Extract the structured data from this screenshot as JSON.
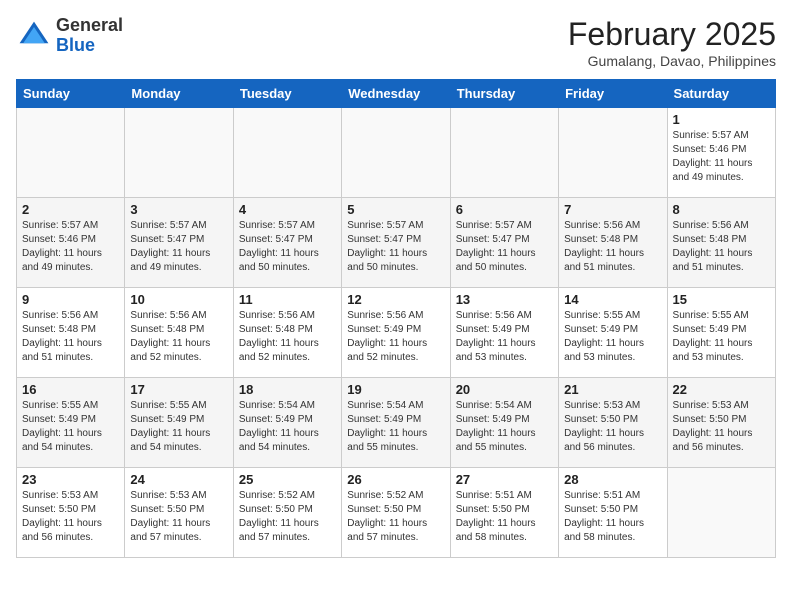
{
  "header": {
    "logo_line1": "General",
    "logo_line2": "Blue",
    "month_year": "February 2025",
    "location": "Gumalang, Davao, Philippines"
  },
  "weekdays": [
    "Sunday",
    "Monday",
    "Tuesday",
    "Wednesday",
    "Thursday",
    "Friday",
    "Saturday"
  ],
  "weeks": [
    [
      {
        "day": "",
        "sunrise": "",
        "sunset": "",
        "daylight": ""
      },
      {
        "day": "",
        "sunrise": "",
        "sunset": "",
        "daylight": ""
      },
      {
        "day": "",
        "sunrise": "",
        "sunset": "",
        "daylight": ""
      },
      {
        "day": "",
        "sunrise": "",
        "sunset": "",
        "daylight": ""
      },
      {
        "day": "",
        "sunrise": "",
        "sunset": "",
        "daylight": ""
      },
      {
        "day": "",
        "sunrise": "",
        "sunset": "",
        "daylight": ""
      },
      {
        "day": "1",
        "sunrise": "Sunrise: 5:57 AM",
        "sunset": "Sunset: 5:46 PM",
        "daylight": "Daylight: 11 hours and 49 minutes."
      }
    ],
    [
      {
        "day": "2",
        "sunrise": "Sunrise: 5:57 AM",
        "sunset": "Sunset: 5:46 PM",
        "daylight": "Daylight: 11 hours and 49 minutes."
      },
      {
        "day": "3",
        "sunrise": "Sunrise: 5:57 AM",
        "sunset": "Sunset: 5:47 PM",
        "daylight": "Daylight: 11 hours and 49 minutes."
      },
      {
        "day": "4",
        "sunrise": "Sunrise: 5:57 AM",
        "sunset": "Sunset: 5:47 PM",
        "daylight": "Daylight: 11 hours and 50 minutes."
      },
      {
        "day": "5",
        "sunrise": "Sunrise: 5:57 AM",
        "sunset": "Sunset: 5:47 PM",
        "daylight": "Daylight: 11 hours and 50 minutes."
      },
      {
        "day": "6",
        "sunrise": "Sunrise: 5:57 AM",
        "sunset": "Sunset: 5:47 PM",
        "daylight": "Daylight: 11 hours and 50 minutes."
      },
      {
        "day": "7",
        "sunrise": "Sunrise: 5:56 AM",
        "sunset": "Sunset: 5:48 PM",
        "daylight": "Daylight: 11 hours and 51 minutes."
      },
      {
        "day": "8",
        "sunrise": "Sunrise: 5:56 AM",
        "sunset": "Sunset: 5:48 PM",
        "daylight": "Daylight: 11 hours and 51 minutes."
      }
    ],
    [
      {
        "day": "9",
        "sunrise": "Sunrise: 5:56 AM",
        "sunset": "Sunset: 5:48 PM",
        "daylight": "Daylight: 11 hours and 51 minutes."
      },
      {
        "day": "10",
        "sunrise": "Sunrise: 5:56 AM",
        "sunset": "Sunset: 5:48 PM",
        "daylight": "Daylight: 11 hours and 52 minutes."
      },
      {
        "day": "11",
        "sunrise": "Sunrise: 5:56 AM",
        "sunset": "Sunset: 5:48 PM",
        "daylight": "Daylight: 11 hours and 52 minutes."
      },
      {
        "day": "12",
        "sunrise": "Sunrise: 5:56 AM",
        "sunset": "Sunset: 5:49 PM",
        "daylight": "Daylight: 11 hours and 52 minutes."
      },
      {
        "day": "13",
        "sunrise": "Sunrise: 5:56 AM",
        "sunset": "Sunset: 5:49 PM",
        "daylight": "Daylight: 11 hours and 53 minutes."
      },
      {
        "day": "14",
        "sunrise": "Sunrise: 5:55 AM",
        "sunset": "Sunset: 5:49 PM",
        "daylight": "Daylight: 11 hours and 53 minutes."
      },
      {
        "day": "15",
        "sunrise": "Sunrise: 5:55 AM",
        "sunset": "Sunset: 5:49 PM",
        "daylight": "Daylight: 11 hours and 53 minutes."
      }
    ],
    [
      {
        "day": "16",
        "sunrise": "Sunrise: 5:55 AM",
        "sunset": "Sunset: 5:49 PM",
        "daylight": "Daylight: 11 hours and 54 minutes."
      },
      {
        "day": "17",
        "sunrise": "Sunrise: 5:55 AM",
        "sunset": "Sunset: 5:49 PM",
        "daylight": "Daylight: 11 hours and 54 minutes."
      },
      {
        "day": "18",
        "sunrise": "Sunrise: 5:54 AM",
        "sunset": "Sunset: 5:49 PM",
        "daylight": "Daylight: 11 hours and 54 minutes."
      },
      {
        "day": "19",
        "sunrise": "Sunrise: 5:54 AM",
        "sunset": "Sunset: 5:49 PM",
        "daylight": "Daylight: 11 hours and 55 minutes."
      },
      {
        "day": "20",
        "sunrise": "Sunrise: 5:54 AM",
        "sunset": "Sunset: 5:49 PM",
        "daylight": "Daylight: 11 hours and 55 minutes."
      },
      {
        "day": "21",
        "sunrise": "Sunrise: 5:53 AM",
        "sunset": "Sunset: 5:50 PM",
        "daylight": "Daylight: 11 hours and 56 minutes."
      },
      {
        "day": "22",
        "sunrise": "Sunrise: 5:53 AM",
        "sunset": "Sunset: 5:50 PM",
        "daylight": "Daylight: 11 hours and 56 minutes."
      }
    ],
    [
      {
        "day": "23",
        "sunrise": "Sunrise: 5:53 AM",
        "sunset": "Sunset: 5:50 PM",
        "daylight": "Daylight: 11 hours and 56 minutes."
      },
      {
        "day": "24",
        "sunrise": "Sunrise: 5:53 AM",
        "sunset": "Sunset: 5:50 PM",
        "daylight": "Daylight: 11 hours and 57 minutes."
      },
      {
        "day": "25",
        "sunrise": "Sunrise: 5:52 AM",
        "sunset": "Sunset: 5:50 PM",
        "daylight": "Daylight: 11 hours and 57 minutes."
      },
      {
        "day": "26",
        "sunrise": "Sunrise: 5:52 AM",
        "sunset": "Sunset: 5:50 PM",
        "daylight": "Daylight: 11 hours and 57 minutes."
      },
      {
        "day": "27",
        "sunrise": "Sunrise: 5:51 AM",
        "sunset": "Sunset: 5:50 PM",
        "daylight": "Daylight: 11 hours and 58 minutes."
      },
      {
        "day": "28",
        "sunrise": "Sunrise: 5:51 AM",
        "sunset": "Sunset: 5:50 PM",
        "daylight": "Daylight: 11 hours and 58 minutes."
      },
      {
        "day": "",
        "sunrise": "",
        "sunset": "",
        "daylight": ""
      }
    ]
  ]
}
